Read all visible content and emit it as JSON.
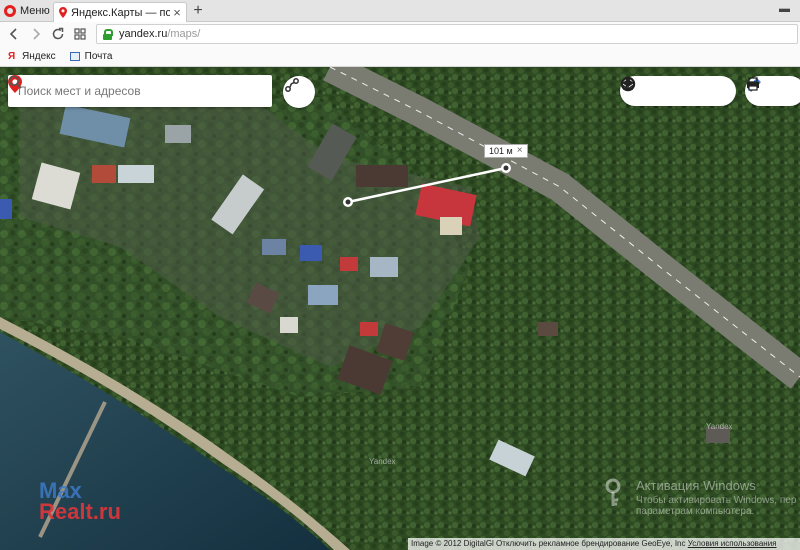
{
  "browser": {
    "menu_label": "Меню",
    "tab_title": "Яндекс.Карты — подроб",
    "tab_close": "×",
    "new_tab": "+",
    "window_control": "▬",
    "url_host": "yandex.ru",
    "url_path": "/maps/",
    "bookmarks": [
      {
        "label": "Яндекс",
        "icon": "yandex-icon"
      },
      {
        "label": "Почта",
        "icon": "mail-icon"
      }
    ]
  },
  "map": {
    "search_placeholder": "Поиск мест и адресов",
    "ruler_distance": "101 м",
    "ruler_close": "×",
    "copyright": "Image © 2012 DigitalGl",
    "copyright_mid": " Отключить рекламное брендирование ",
    "copyright_geoeye": "GeoEye, Inc ",
    "copyright_terms": "Условия использования",
    "watermark_yandex_1": "Yandex",
    "watermark_yandex_2": "Yandex"
  },
  "watermarks": {
    "windows_title": "Активация Windows",
    "windows_line1": "Чтобы активировать Windows, пер",
    "windows_line2": "параметрам компьютера.",
    "site_line1": "Max",
    "site_line2": "Realt.ru"
  },
  "colors": {
    "brand_red": "#e2201f",
    "secure_green": "#2e9e2e",
    "forest": "#2f4a23",
    "sea": "#1f3a4a"
  }
}
